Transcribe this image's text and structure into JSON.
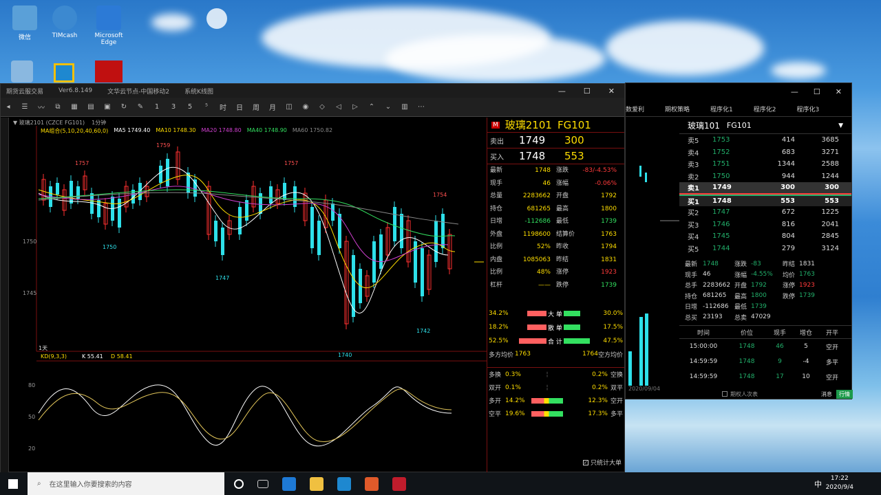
{
  "desktop": {
    "icons": [
      {
        "label": "微信"
      },
      {
        "label": "TIMcash"
      },
      {
        "label": "Microsoft Edge"
      }
    ]
  },
  "main": {
    "title_items": [
      "期货云服交易",
      "Ver6.8.149",
      "文华云节点-中国移动2",
      "系统K线图"
    ],
    "window_buttons": [
      "—",
      "☐",
      "✕"
    ],
    "contract_line": "▼ 玻璃2101 (CZCE FG101)",
    "period": "1分钟",
    "ma_line": [
      {
        "text": "MA组合(5,10,20,40,60,0)",
        "color": "#ffde00"
      },
      {
        "text": "MA5 1749.40",
        "color": "#ffffff"
      },
      {
        "text": "MA10 1748.30",
        "color": "#ffde00"
      },
      {
        "text": "MA20 1748.80",
        "color": "#d040d0"
      },
      {
        "text": "MA40 1748.90",
        "color": "#33e060"
      },
      {
        "text": "MA60 1750.82",
        "color": "#888888"
      }
    ],
    "price_labels": [
      "1757",
      "1759",
      "1757",
      "1750",
      "1747",
      "1740",
      "1742",
      "1754"
    ],
    "yaxis": [
      "1750",
      "1745"
    ],
    "kd_header": "KD(9,3,3)",
    "kd_k": "K 55.41",
    "kd_d": "D 58.41",
    "kd_axis": [
      "80",
      "50",
      "20"
    ],
    "bottom_tag": "1天",
    "side": {
      "marker": "M",
      "name": "玻璃2101",
      "code": "FG101",
      "sell": {
        "label": "卖出",
        "price": "1749",
        "vol": "300"
      },
      "buy": {
        "label": "买入",
        "price": "1748",
        "vol": "553"
      },
      "stats": [
        [
          "最新",
          "1748",
          "涨跌",
          "-83/-4.53%"
        ],
        [
          "现手",
          "46",
          "涨幅",
          "-0.06%"
        ],
        [
          "总量",
          "2283662",
          "开盘",
          "1792"
        ],
        [
          "持仓",
          "681265",
          "最高",
          "1800"
        ],
        [
          "日增",
          "-112686",
          "最低",
          "1739"
        ],
        [
          "外盘",
          "1198600",
          "结算价",
          "1763"
        ],
        [
          "比例",
          "52%",
          "昨收",
          "1794"
        ],
        [
          "内盘",
          "1085063",
          "昨结",
          "1831"
        ],
        [
          "比例",
          "48%",
          "涨停",
          "1923"
        ],
        [
          "杠杆",
          "——",
          "跌停",
          "1739"
        ]
      ],
      "flow": [
        {
          "left": "34.2%",
          "label": "大 单",
          "right": "30.0%"
        },
        {
          "left": "18.2%",
          "label": "散 单",
          "right": "17.5%"
        },
        {
          "left": "52.5%",
          "label": "合 计",
          "right": "47.5%"
        }
      ],
      "avg_left": "多方均价",
      "avg_left_val": "1763",
      "avg_right_val": "1764",
      "avg_right": "空方均价",
      "positions": [
        {
          "l": "多换",
          "lv": "0.3%",
          "rv": "0.2%",
          "r": "空换"
        },
        {
          "l": "双开",
          "lv": "0.1%",
          "rv": "0.2%",
          "r": "双平"
        },
        {
          "l": "多开",
          "lv": "14.2%",
          "rv": "12.3%",
          "r": "空开"
        },
        {
          "l": "空平",
          "lv": "19.6%",
          "rv": "17.3%",
          "r": "多平"
        }
      ],
      "checkbox": "只统计大单"
    }
  },
  "right": {
    "tabs": [
      "数爱利",
      "期权策略",
      "程序化1",
      "程序化2",
      "程序化3"
    ],
    "contract": "玻璃101",
    "code": "FG101",
    "asks": [
      [
        "卖5",
        "1753",
        "414",
        "3685"
      ],
      [
        "卖4",
        "1752",
        "683",
        "3271"
      ],
      [
        "卖3",
        "1751",
        "1344",
        "2588"
      ],
      [
        "卖2",
        "1750",
        "944",
        "1244"
      ],
      [
        "卖1",
        "1749",
        "300",
        "300"
      ]
    ],
    "bids": [
      [
        "买1",
        "1748",
        "553",
        "553"
      ],
      [
        "买2",
        "1747",
        "672",
        "1225"
      ],
      [
        "买3",
        "1746",
        "816",
        "2041"
      ],
      [
        "买4",
        "1745",
        "804",
        "2845"
      ],
      [
        "买5",
        "1744",
        "279",
        "3124"
      ]
    ],
    "summary": [
      [
        "最新",
        "1748",
        "涨跌",
        "-83",
        "昨结",
        "1831"
      ],
      [
        "现手",
        "46",
        "涨幅",
        "-4.55%",
        "均价",
        "1763"
      ],
      [
        "总手",
        "2283662",
        "开盘",
        "1792",
        "涨停",
        "1923"
      ],
      [
        "持仓",
        "681265",
        "最高",
        "1800",
        "跌停",
        "1739"
      ],
      [
        "日增",
        "-112686",
        "最低",
        "1739",
        "",
        ""
      ],
      [
        "总买",
        "23193",
        "总卖",
        "47029",
        "",
        ""
      ]
    ],
    "ticks_header": [
      "时间",
      "价位",
      "现手",
      "增仓",
      "开平"
    ],
    "ticks": [
      [
        "15:00:00",
        "1748",
        "46",
        "5",
        "空开"
      ],
      [
        "14:59:59",
        "1748",
        "9",
        "-4",
        "多平"
      ],
      [
        "14:59:59",
        "1748",
        "17",
        "10",
        "空开"
      ]
    ],
    "footer_left": "期权人次表",
    "footer_msg": "消息",
    "footer_btn": "行情",
    "date": "2020/09/04"
  },
  "taskbar": {
    "search_placeholder": "在这里输入你要搜索的内容",
    "time": "17:22",
    "date": "2020/9/4",
    "ime": "中"
  }
}
